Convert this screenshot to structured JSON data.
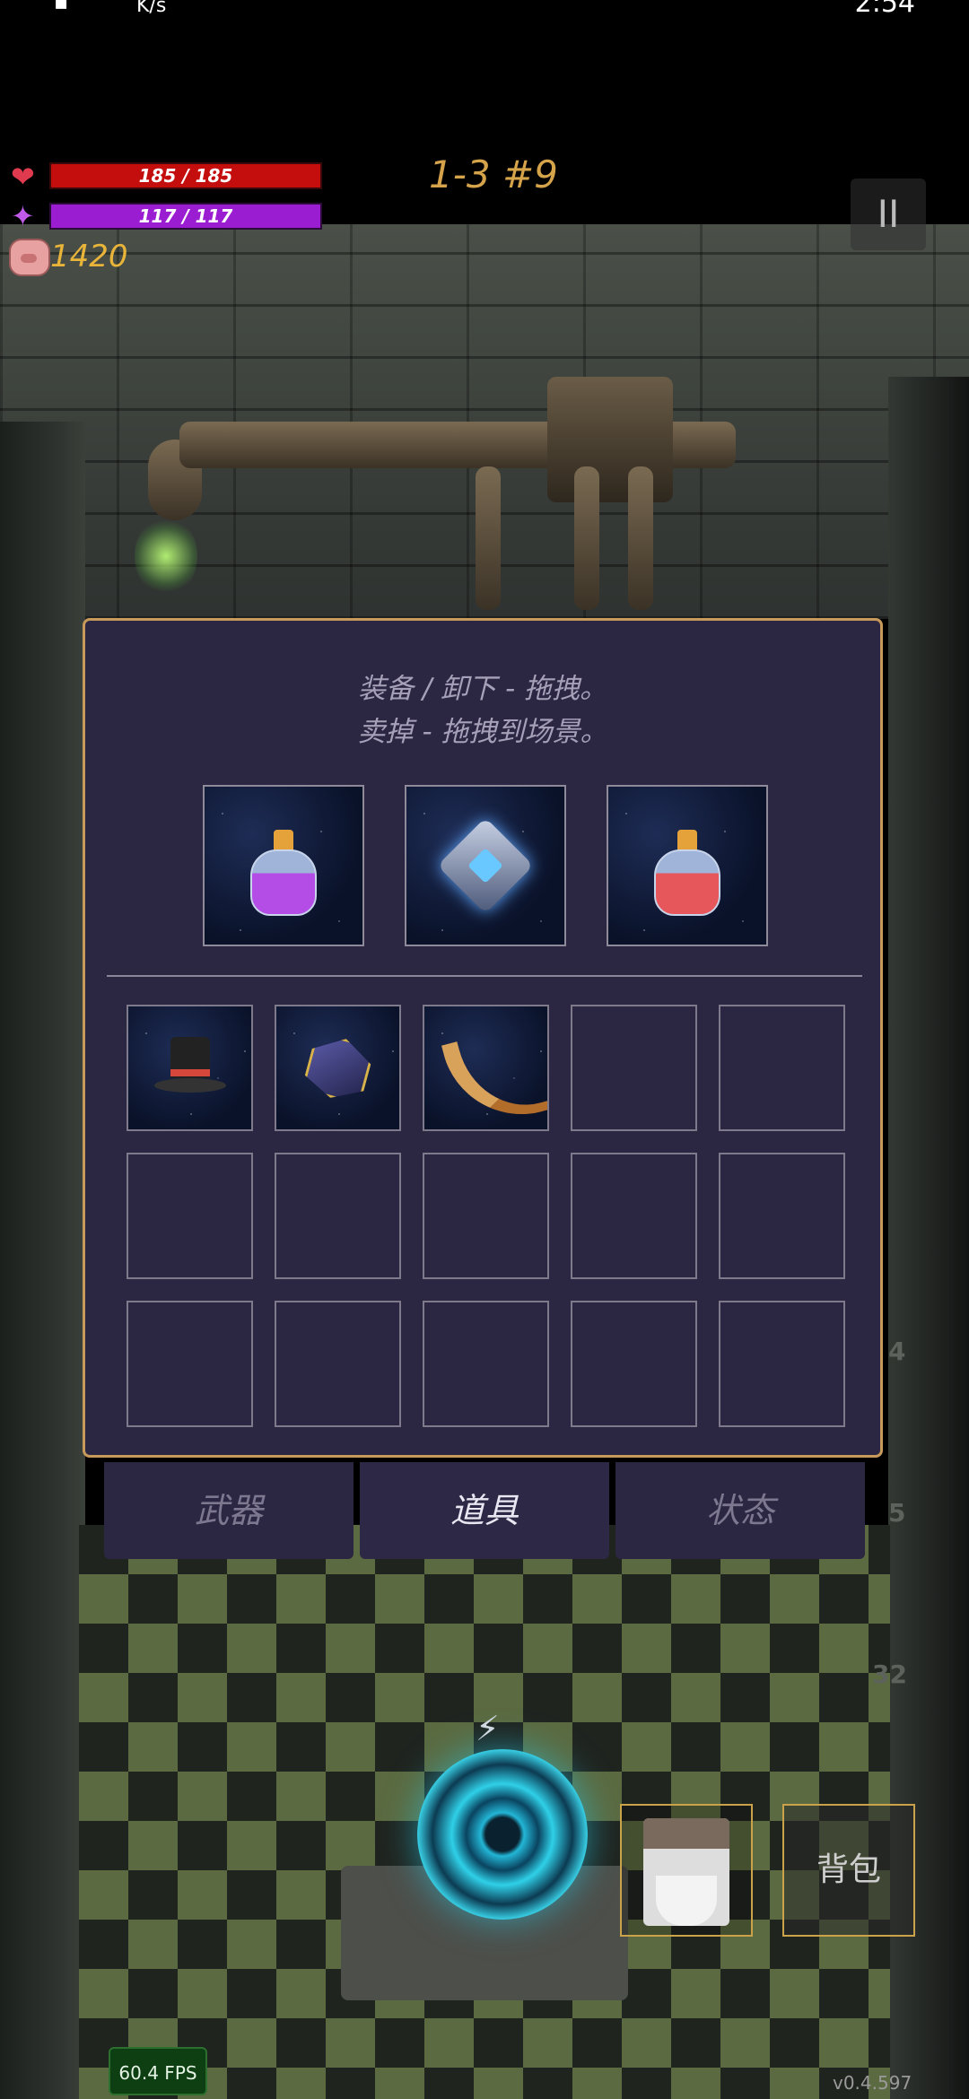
{
  "status_bar": {
    "net": "K/s",
    "time": "2:54"
  },
  "hud": {
    "hp": "185 / 185",
    "mp": "117 / 117",
    "gold": "1420",
    "level": "1-3 #9",
    "pause": "II"
  },
  "panel": {
    "hint_line1": "装备 / 卸下 - 拖拽。",
    "hint_line2": "卖掉 - 拖拽到场景。",
    "equipped": [
      {
        "icon": "purple-potion-icon",
        "color": "#b44de6"
      },
      {
        "icon": "glowing-cube-icon",
        "color": "#69c8ff"
      },
      {
        "icon": "red-potion-icon",
        "color": "#e5575b"
      }
    ],
    "inventory": [
      {
        "icon": "top-hat-icon"
      },
      {
        "icon": "d20-dice-icon"
      },
      {
        "icon": "horn-icon"
      },
      null,
      null,
      null,
      null,
      null,
      null,
      null,
      null,
      null,
      null,
      null,
      null
    ]
  },
  "tabs": [
    "武器",
    "道具",
    "状态"
  ],
  "active_tab": "道具",
  "bag_label": "背包",
  "fps": "60.4 FPS",
  "version": "v0.4.597",
  "side_numbers": [
    "4",
    "5",
    "32"
  ]
}
